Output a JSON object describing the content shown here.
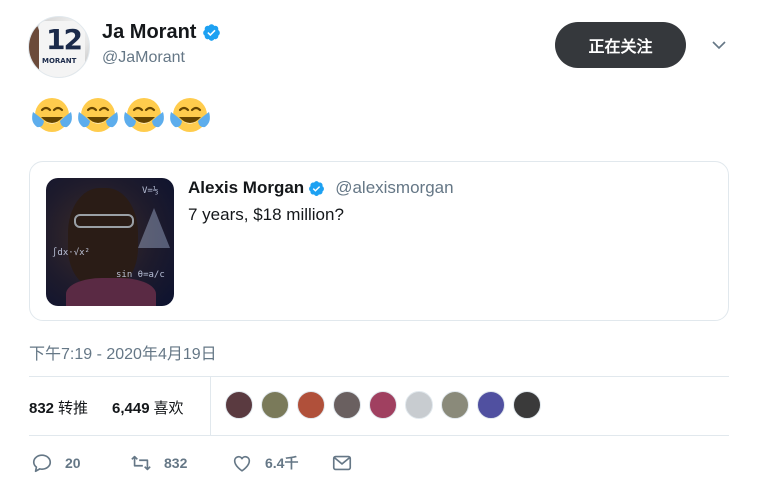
{
  "author": {
    "display_name": "Ja Morant",
    "handle": "@JaMorant",
    "avatar_jersey_number": "12",
    "avatar_jersey_name": "MORANT"
  },
  "follow_button": {
    "label": "正在关注"
  },
  "tweet": {
    "emoji_count": 4,
    "emoji_name": "face-with-tears-of-joy"
  },
  "quoted_tweet": {
    "display_name": "Alexis Morgan",
    "handle": "@alexismorgan",
    "text": "7 years, $18 million?"
  },
  "timestamp": "下午7:19 - 2020年4月19日",
  "stats": {
    "retweets_count": "832",
    "retweets_label": "转推",
    "likes_count": "6,449",
    "likes_label": "喜欢",
    "liker_avatars": [
      {
        "color": "#5a3a40"
      },
      {
        "color": "#7a7a5a"
      },
      {
        "color": "#b0503a"
      },
      {
        "color": "#6a6060"
      },
      {
        "color": "#a04060"
      },
      {
        "color": "#c8ccd0"
      },
      {
        "color": "#8a8a7a"
      },
      {
        "color": "#5050a0"
      },
      {
        "color": "#3a3a3a"
      }
    ]
  },
  "actions": {
    "reply_count": "20",
    "retweet_count": "832",
    "like_count": "6.4千"
  },
  "colors": {
    "verified": "#1da1f2",
    "secondary_text": "#657786",
    "follow_button_bg": "#35383c",
    "border": "#e1e8ed"
  }
}
